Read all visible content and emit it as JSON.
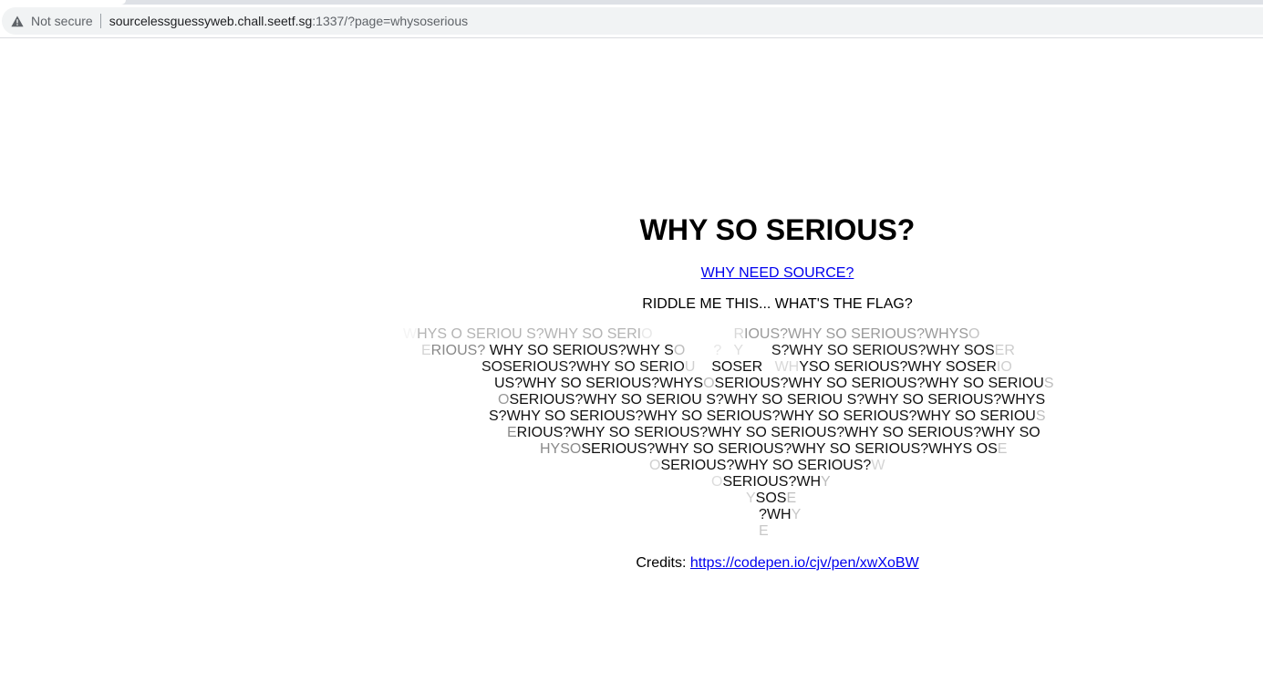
{
  "browser": {
    "security_label": "Not secure",
    "url_host": "sourcelessguessyweb.chall.seetf.sg",
    "url_rest": ":1337/?page=whysoserious",
    "warning_icon": "warning-triangle-icon"
  },
  "page": {
    "title": "WHY SO SERIOUS?",
    "source_link": "WHY NEED SOURCE?",
    "riddle": "RIDDLE ME THIS... WHAT'S THE FLAG?",
    "credits_label": "Credits: ",
    "credits_link": "https://codepen.io/cjv/pen/xwXoBW"
  },
  "art": {
    "lines": [
      [
        {
          "t": "W",
          "c": "#f4f4f4"
        },
        {
          "t": "HYS O SERIOU S?WHY SO SERI",
          "c": "#b4b4b4"
        },
        {
          "t": "O",
          "c": "#e8e8e8"
        },
        {
          "t": "                    ",
          "c": "#ffffff"
        },
        {
          "t": "R",
          "c": "#d8d8d8"
        },
        {
          "t": "IOUS?WHY SO SERIOUS?WHYS",
          "c": "#9a9a9a"
        },
        {
          "t": "O",
          "c": "#c4c4c4"
        }
      ],
      [
        {
          "t": "E",
          "c": "#d4d4d4"
        },
        {
          "t": "RIOUS? ",
          "c": "#888888"
        },
        {
          "t": "WHY SO SERIOUS?WHY S",
          "c": "#111111"
        },
        {
          "t": "O",
          "c": "#bdbdbd"
        },
        {
          "t": "       ",
          "c": "#ffffff"
        },
        {
          "t": "?",
          "c": "#e6e6e6"
        },
        {
          "t": "   ",
          "c": "#ffffff"
        },
        {
          "t": "Y",
          "c": "#dddddd"
        },
        {
          "t": "       ",
          "c": "#ffffff"
        },
        {
          "t": "S?WHY SO SERIOUS?WHY SOS",
          "c": "#1a1a1a"
        },
        {
          "t": "ER",
          "c": "#cccccc"
        }
      ],
      [
        {
          "t": "SOSERIOUS?WHY SO SERIO",
          "c": "#1a1a1a"
        },
        {
          "t": "U",
          "c": "#d0d0d0"
        },
        {
          "t": "    ",
          "c": "#ffffff"
        },
        {
          "t": "SOSER",
          "c": "#111111"
        },
        {
          "t": "   ",
          "c": "#ffffff"
        },
        {
          "t": "WH",
          "c": "#d8d8d8"
        },
        {
          "t": "YSO SERIOUS?WHY SOSER",
          "c": "#111111"
        },
        {
          "t": "IO",
          "c": "#cfcfcf"
        }
      ],
      [
        {
          "t": "US?WHY SO SERIOUS?WHYS",
          "c": "#111111"
        },
        {
          "t": "O",
          "c": "#bdbdbd"
        },
        {
          "t": "SERIOUS?WHY SO SERIOUS?WHY SO SERIOU",
          "c": "#111111"
        },
        {
          "t": "S",
          "c": "#bdbdbd"
        }
      ],
      [
        {
          "t": "O",
          "c": "#999999"
        },
        {
          "t": "SERIOUS?WHY SO SERIOU S?WHY SO SERIOU S?WHY SO SERIOUS?WHYS",
          "c": "#111111"
        }
      ],
      [
        {
          "t": "S?WHY SO SERIOUS?WHY SO SERIOUS?WHY SO SERIOUS?WHY SO SERIOU",
          "c": "#111111"
        },
        {
          "t": "S",
          "c": "#bdbdbd"
        }
      ],
      [
        {
          "t": "E",
          "c": "#8a8a8a"
        },
        {
          "t": "RIOUS?WHY SO SERIOUS?WHY SO SERIOUS?WHY SO SERIOUS?WHY SO",
          "c": "#111111"
        }
      ],
      [
        {
          "t": "HYSO",
          "c": "#8a8a8a"
        },
        {
          "t": "SERIOUS?WHY SO SERIOUS?WHY SO SERIOUS?WHYS OS",
          "c": "#111111"
        },
        {
          "t": "E",
          "c": "#c8c8c8"
        }
      ],
      [
        {
          "t": "O",
          "c": "#cfcfcf"
        },
        {
          "t": "SERIOUS?WHY SO SERIOUS?",
          "c": "#111111"
        },
        {
          "t": "W",
          "c": "#d4d4d4"
        }
      ],
      [
        {
          "t": "O",
          "c": "#dcdcdc"
        },
        {
          "t": "SERIOUS?WH",
          "c": "#111111"
        },
        {
          "t": "Y",
          "c": "#bdbdbd"
        }
      ],
      [
        {
          "t": "Y",
          "c": "#d0d0d0"
        },
        {
          "t": "SOS",
          "c": "#111111"
        },
        {
          "t": "E",
          "c": "#c0c0c0"
        }
      ],
      [
        {
          "t": "?WH",
          "c": "#111111"
        },
        {
          "t": "Y",
          "c": "#c8c8c8"
        }
      ],
      [
        {
          "t": "E",
          "c": "#c8c8c8"
        }
      ]
    ]
  }
}
